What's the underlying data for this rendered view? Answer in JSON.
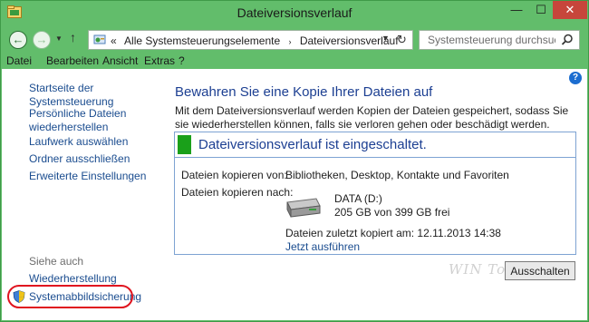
{
  "window": {
    "title": "Dateiversionsverlauf",
    "controls": {
      "minimize": "—",
      "maximize": "☐",
      "close": "✕"
    }
  },
  "navigation": {
    "back": "←",
    "forward": "→",
    "recent_menu": "▼",
    "up": "↑"
  },
  "address": {
    "chevron": "«",
    "breadcrumbs": [
      "Alle Systemsteuerungselemente",
      "Dateiversionsverlauf"
    ],
    "separator": "›",
    "dropdown": "▼",
    "refresh": "↻"
  },
  "search": {
    "placeholder": "Systemsteuerung durchsuchen"
  },
  "menu": {
    "items": [
      "Datei",
      "Bearbeiten",
      "Ansicht",
      "Extras",
      "?"
    ]
  },
  "help_icon": "?",
  "sidebar": {
    "links": [
      "Startseite der Systemsteuerung",
      "Persönliche Dateien wiederherstellen",
      "Laufwerk auswählen",
      "Ordner ausschließen",
      "Erweiterte Einstellungen"
    ],
    "see_also_heading": "Siehe auch",
    "see_also": [
      "Wiederherstellung",
      "Systemabbildsicherung"
    ]
  },
  "main": {
    "heading": "Bewahren Sie eine Kopie Ihrer Dateien auf",
    "description": "Mit dem Dateiversionsverlauf werden Kopien der Dateien gespeichert, sodass Sie sie wiederherstellen können, falls sie verloren gehen oder beschädigt werden.",
    "status": {
      "title": "Dateiversionsverlauf ist eingeschaltet.",
      "copy_from_label": "Dateien kopieren von:",
      "copy_from_value": "Bibliotheken, Desktop, Kontakte und Favoriten",
      "copy_to_label": "Dateien kopieren nach:",
      "drive_name": "DATA (D:)",
      "drive_space": "205 GB von 399 GB frei",
      "last_copied": "Dateien zuletzt kopiert am: 12.11.2013 14:38",
      "run_now": "Jetzt ausführen"
    },
    "turn_off_button": "Ausschalten"
  },
  "watermark": "WIN Tools",
  "colors": {
    "window_frame": "#62bd6b",
    "link": "#1a4c8f",
    "heading": "#1c3f92",
    "status_indicator": "#1aa01a",
    "highlight_ring": "#e0141f",
    "close_button": "#c7463b"
  }
}
